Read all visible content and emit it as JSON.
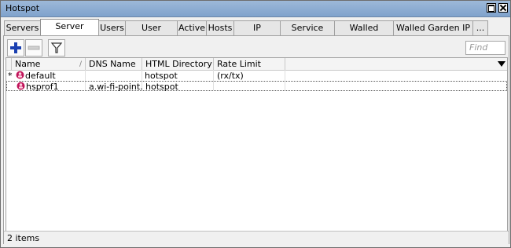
{
  "window": {
    "title": "Hotspot"
  },
  "tabs": [
    {
      "label": "Servers"
    },
    {
      "label": "Server Profiles"
    },
    {
      "label": "Users"
    },
    {
      "label": "User Profiles"
    },
    {
      "label": "Active"
    },
    {
      "label": "Hosts"
    },
    {
      "label": "IP Bindings"
    },
    {
      "label": "Service Ports"
    },
    {
      "label": "Walled Garden"
    },
    {
      "label": "Walled Garden IP List"
    },
    {
      "label": "..."
    }
  ],
  "active_tab": "Server Profiles",
  "toolbar": {
    "add_icon": "plus-icon",
    "remove_icon": "minus-icon",
    "filter_icon": "filter-icon",
    "find_placeholder": "Find"
  },
  "table": {
    "columns": [
      "Name",
      "DNS Name",
      "HTML Directory",
      "Rate Limit (rx/tx)"
    ],
    "rows": [
      {
        "flag": "*",
        "name": "default",
        "dns_name": "",
        "html_directory": "hotspot",
        "rate_limit": ""
      },
      {
        "flag": "",
        "name": "hsprof1",
        "dns_name": "a.wi-fi-point.c...",
        "html_directory": "hotspot",
        "rate_limit": ""
      }
    ]
  },
  "status": {
    "text": "2 items"
  },
  "colors": {
    "title_bar": "#8fadd3",
    "add_icon": "#1a3fb0",
    "profile_icon": "#c0145a"
  }
}
